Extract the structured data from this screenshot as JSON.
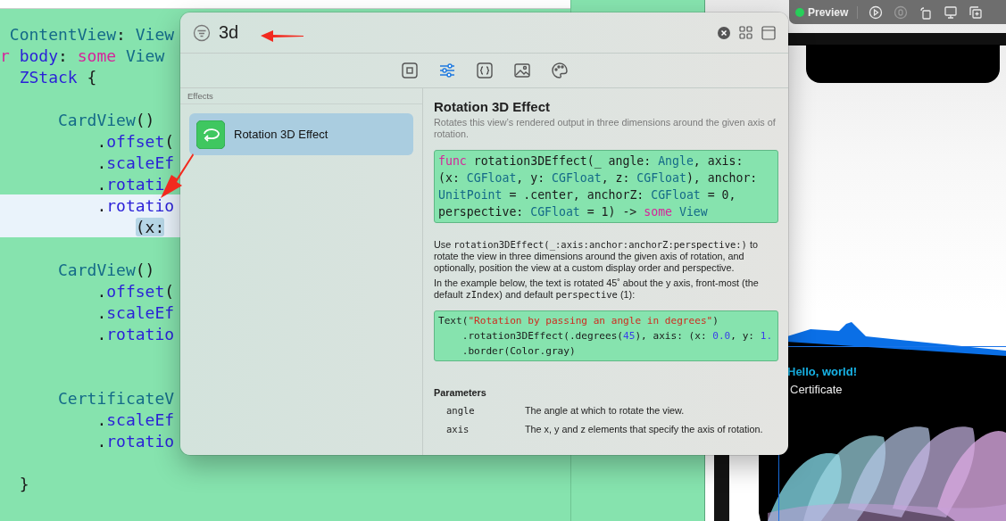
{
  "editor": {
    "lines": [
      {
        "kind": "code",
        "highlighted": false,
        "tokens": [
          {
            "kind": "type",
            "text": " ContentView"
          },
          {
            "kind": "plain",
            "text": ": "
          },
          {
            "kind": "type",
            "text": "View"
          }
        ]
      },
      {
        "kind": "code",
        "highlighted": false,
        "tokens": [
          {
            "kind": "keyword",
            "text": "r"
          },
          {
            "kind": "member",
            "text": " body"
          },
          {
            "kind": "plain",
            "text": ": "
          },
          {
            "kind": "keyword",
            "text": "some"
          },
          {
            "kind": "type",
            "text": " View"
          }
        ]
      },
      {
        "kind": "code",
        "highlighted": false,
        "tokens": [
          {
            "kind": "member",
            "text": "  ZStack"
          },
          {
            "kind": "plain",
            "text": " {"
          }
        ]
      },
      {
        "kind": "blank",
        "highlighted": false
      },
      {
        "kind": "code",
        "highlighted": false,
        "tokens": [
          {
            "kind": "type",
            "text": "      CardView"
          },
          {
            "kind": "plain",
            "text": "()"
          }
        ]
      },
      {
        "kind": "code",
        "highlighted": false,
        "tokens": [
          {
            "kind": "plain",
            "text": "          ."
          },
          {
            "kind": "member",
            "text": "offset"
          },
          {
            "kind": "plain",
            "text": "("
          }
        ]
      },
      {
        "kind": "code",
        "highlighted": false,
        "tokens": [
          {
            "kind": "plain",
            "text": "          ."
          },
          {
            "kind": "member",
            "text": "scaleEf"
          }
        ]
      },
      {
        "kind": "code",
        "highlighted": false,
        "tokens": [
          {
            "kind": "plain",
            "text": "          ."
          },
          {
            "kind": "member",
            "text": "rotati"
          }
        ]
      },
      {
        "kind": "code",
        "highlighted": true,
        "tokens": [
          {
            "kind": "plain",
            "text": "          ."
          },
          {
            "kind": "member",
            "text": "rotatio"
          }
        ]
      },
      {
        "kind": "code",
        "highlighted": true,
        "tokens": [
          {
            "kind": "selected",
            "text": "              (x:"
          }
        ]
      },
      {
        "kind": "blank",
        "highlighted": false
      },
      {
        "kind": "code",
        "highlighted": false,
        "tokens": [
          {
            "kind": "type",
            "text": "      CardView"
          },
          {
            "kind": "plain",
            "text": "()"
          }
        ]
      },
      {
        "kind": "code",
        "highlighted": false,
        "tokens": [
          {
            "kind": "plain",
            "text": "          ."
          },
          {
            "kind": "member",
            "text": "offset"
          },
          {
            "kind": "plain",
            "text": "("
          }
        ]
      },
      {
        "kind": "code",
        "highlighted": false,
        "tokens": [
          {
            "kind": "plain",
            "text": "          ."
          },
          {
            "kind": "member",
            "text": "scaleEf"
          }
        ]
      },
      {
        "kind": "code",
        "highlighted": false,
        "tokens": [
          {
            "kind": "plain",
            "text": "          ."
          },
          {
            "kind": "member",
            "text": "rotatio"
          }
        ]
      },
      {
        "kind": "blank",
        "highlighted": false
      },
      {
        "kind": "blank",
        "highlighted": false
      },
      {
        "kind": "code",
        "highlighted": false,
        "tokens": [
          {
            "kind": "type",
            "text": "      CertificateV"
          }
        ]
      },
      {
        "kind": "code",
        "highlighted": false,
        "tokens": [
          {
            "kind": "plain",
            "text": "          ."
          },
          {
            "kind": "member",
            "text": "scaleEf"
          }
        ]
      },
      {
        "kind": "code",
        "highlighted": false,
        "tokens": [
          {
            "kind": "plain",
            "text": "          ."
          },
          {
            "kind": "member",
            "text": "rotatio"
          }
        ]
      },
      {
        "kind": "blank",
        "highlighted": false
      },
      {
        "kind": "code",
        "highlighted": false,
        "tokens": [
          {
            "kind": "plain",
            "text": "  }"
          }
        ]
      }
    ]
  },
  "library": {
    "search": {
      "value": "3d"
    },
    "tabs": [
      {
        "kind": "views",
        "selected": false
      },
      {
        "kind": "modifiers",
        "selected": true
      },
      {
        "kind": "snippets",
        "selected": false
      },
      {
        "kind": "media",
        "selected": false
      },
      {
        "kind": "colors",
        "selected": false
      }
    ],
    "section": "Effects",
    "items": [
      {
        "label": "Rotation 3D Effect",
        "selected": true
      }
    ],
    "detail": {
      "title": "Rotation 3D Effect",
      "summary": "Rotates this view’s rendered output in three dimensions around the given axis of rotation.",
      "declaration": [
        [
          {
            "kind": "keyword",
            "text": "func"
          },
          {
            "kind": "plain",
            "text": " rotation3DEffect(_ angle: "
          },
          {
            "kind": "type",
            "text": "Angle"
          },
          {
            "kind": "plain",
            "text": ", axis:"
          }
        ],
        [
          {
            "kind": "plain",
            "text": "(x: "
          },
          {
            "kind": "type",
            "text": "CGFloat"
          },
          {
            "kind": "plain",
            "text": ", y: "
          },
          {
            "kind": "type",
            "text": "CGFloat"
          },
          {
            "kind": "plain",
            "text": ", z: "
          },
          {
            "kind": "type",
            "text": "CGFloat"
          },
          {
            "kind": "plain",
            "text": "), anchor:"
          }
        ],
        [
          {
            "kind": "type",
            "text": "UnitPoint"
          },
          {
            "kind": "plain",
            "text": " = .center, anchorZ: "
          },
          {
            "kind": "type",
            "text": "CGFloat"
          },
          {
            "kind": "plain",
            "text": " = 0,"
          }
        ],
        [
          {
            "kind": "plain",
            "text": "perspective: "
          },
          {
            "kind": "type",
            "text": "CGFloat"
          },
          {
            "kind": "plain",
            "text": " = 1) -> "
          },
          {
            "kind": "keyword",
            "text": "some"
          },
          {
            "kind": "type",
            "text": " View"
          }
        ]
      ],
      "paragraphs": [
        [
          {
            "kind": "text",
            "text": "Use "
          },
          {
            "kind": "code",
            "text": "rotation3DEffect(_:axis:anchor:anchorZ:perspective:)"
          },
          {
            "kind": "text",
            "text": " to rotate the view in three dimensions around the given axis of rotation, and optionally, position the view at a custom display order and perspective."
          }
        ],
        [
          {
            "kind": "text",
            "text": "In the example below, the text is rotated 45˚ about the y axis, front-most (the default "
          },
          {
            "kind": "code",
            "text": "zIndex"
          },
          {
            "kind": "text",
            "text": ") and default "
          },
          {
            "kind": "code",
            "text": "perspective"
          },
          {
            "kind": "text",
            "text": " (1):"
          }
        ]
      ],
      "example": [
        [
          {
            "kind": "plain",
            "text": "Text("
          },
          {
            "kind": "string",
            "text": "\"Rotation by passing an angle in degrees\""
          },
          {
            "kind": "plain",
            "text": ")"
          }
        ],
        [
          {
            "kind": "plain",
            "text": "    .rotation3DEffect(.degrees("
          },
          {
            "kind": "number",
            "text": "45"
          },
          {
            "kind": "plain",
            "text": "), axis: (x: "
          },
          {
            "kind": "number",
            "text": "0.0"
          },
          {
            "kind": "plain",
            "text": ", y: "
          },
          {
            "kind": "number",
            "text": "1."
          }
        ],
        [
          {
            "kind": "plain",
            "text": "    .border(Color.gray)"
          }
        ]
      ],
      "parameters_title": "Parameters",
      "parameters": [
        {
          "name": "angle",
          "description": "The angle at which to rotate the view."
        },
        {
          "name": "axis",
          "description": "The x, y and z elements that specify the axis of rotation."
        }
      ]
    }
  },
  "preview": {
    "label": "Preview",
    "buttons": [
      {
        "kind": "live",
        "disabled": false
      },
      {
        "kind": "pause",
        "disabled": true
      },
      {
        "kind": "rotate",
        "disabled": false
      },
      {
        "kind": "device",
        "disabled": false
      },
      {
        "kind": "duplicate",
        "disabled": false
      }
    ],
    "card": {
      "title": "Hello, world!",
      "subtitle": "Certificate"
    }
  }
}
